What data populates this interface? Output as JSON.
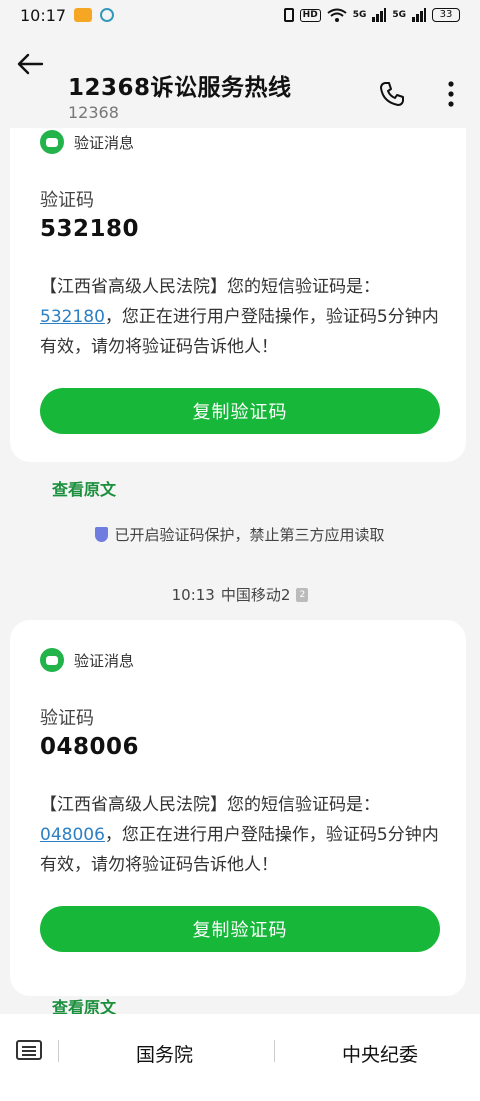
{
  "status_bar": {
    "time": "10:17",
    "hd": "HD",
    "net1": "5G",
    "net2": "5G",
    "battery": "33"
  },
  "header": {
    "title": "12368诉讼服务热线",
    "subtitle": "12368"
  },
  "messages": [
    {
      "tag": "验证消息",
      "label": "验证码",
      "code": "532180",
      "text_prefix": "【江西省高级人民法院】您的短信验证码是：",
      "text_link": "532180",
      "text_suffix": "，您正在进行用户登陆操作，验证码5分钟内有效，请勿将验证码告诉他人！",
      "copy_button": "复制验证码",
      "view_original": "查看原文"
    },
    {
      "tag": "验证消息",
      "label": "验证码",
      "code": "048006",
      "text_prefix": "【江西省高级人民法院】您的短信验证码是：",
      "text_link": "048006",
      "text_suffix": "，您正在进行用户登陆操作，验证码5分钟内有效，请勿将验证码告诉他人！",
      "copy_button": "复制验证码",
      "view_original": "查看原文"
    }
  ],
  "notice": "已开启验证码保护，禁止第三方应用读取",
  "timestamp": {
    "time": "10:13",
    "carrier": "中国移动2",
    "sim": "2"
  },
  "bottom_bar": {
    "item1": "国务院",
    "item2": "中央纪委"
  },
  "colors": {
    "accent_green": "#17b83a",
    "link_blue": "#2d7fc4"
  }
}
